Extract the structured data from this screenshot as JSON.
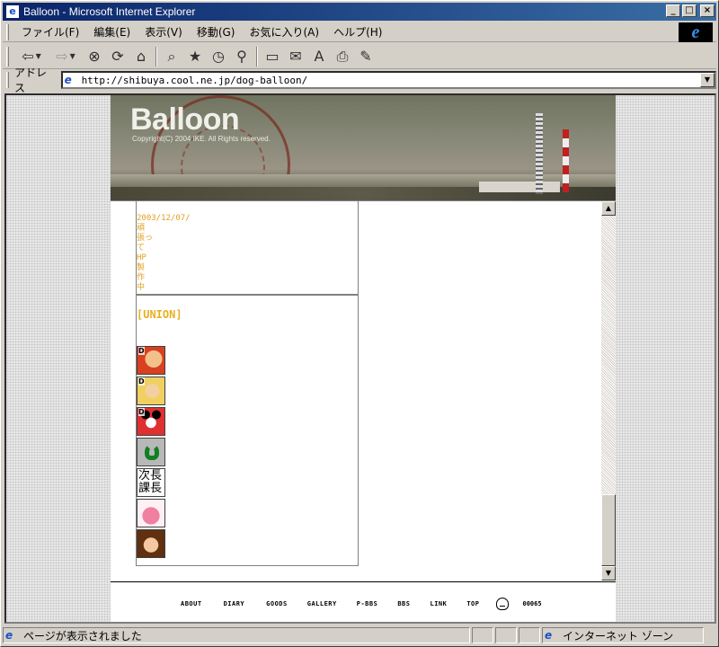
{
  "window": {
    "title": "Balloon - Microsoft Internet Explorer",
    "min_glyph": "_",
    "max_glyph": "□",
    "close_glyph": "×"
  },
  "menu": {
    "items": [
      "ファイル(F)",
      "編集(E)",
      "表示(V)",
      "移動(G)",
      "お気に入り(A)",
      "ヘルプ(H)"
    ]
  },
  "toolbar": {
    "back_glyph": "⇦",
    "forward_glyph": "⇨",
    "stop_glyph": "⊗",
    "refresh_glyph": "⟳",
    "home_glyph": "⌂",
    "search_glyph": "⌕",
    "favorites_glyph": "★",
    "history_glyph": "◷",
    "channels_glyph": "⚲",
    "fullscreen_glyph": "▭",
    "mail_glyph": "✉",
    "font_glyph": "A",
    "print_glyph": "⎙",
    "edit_glyph": "✎"
  },
  "address": {
    "label": "アドレス",
    "url": "http://shibuya.cool.ne.jp/dog-balloon/"
  },
  "site": {
    "brand": "Balloon",
    "copyright": "Copyright(C) 2004 IKE. All Rights reserved.",
    "diary": {
      "date": "2003/12/07/",
      "lines": [
        "頑",
        "張っ",
        "て",
        "HP",
        "製",
        "作",
        "中"
      ]
    },
    "union": {
      "title": "[UNION]",
      "avatar_5_text": "次長課長"
    },
    "footer_nav": [
      "ABOUT",
      "DIARY",
      "GOODS",
      "GALLERY",
      "P-BBS",
      "BBS",
      "LINK",
      "TOP"
    ],
    "counter": "00065"
  },
  "status": {
    "message": "ページが表示されました",
    "zone": "インターネット ゾーン"
  },
  "colors": {
    "title_bar": "#0a246a",
    "chrome": "#d4d0c8",
    "diary_text": "#e0a020",
    "union_title": "#e8b020"
  }
}
